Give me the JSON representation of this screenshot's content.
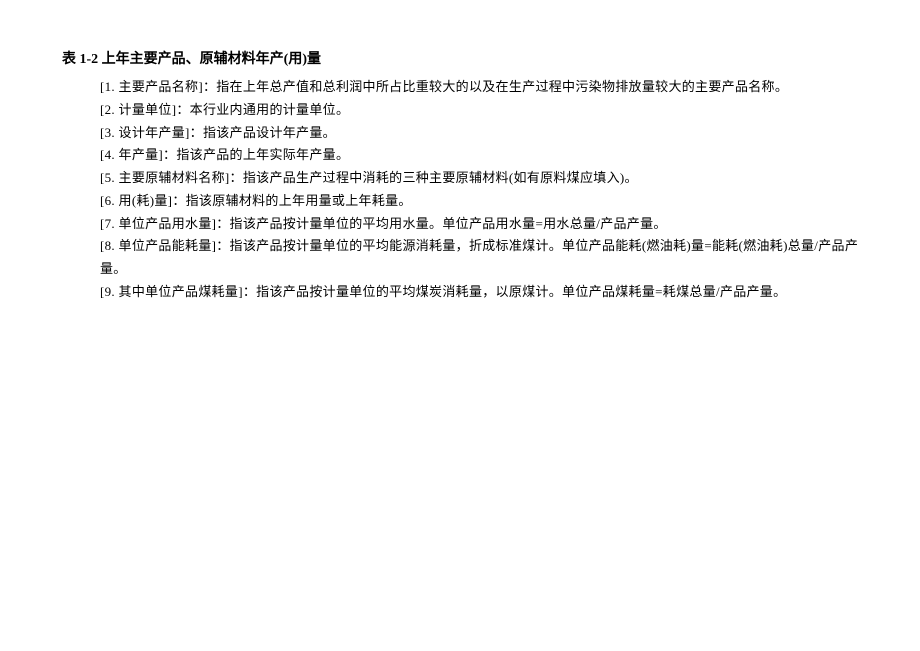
{
  "title": "表 1-2 上年主要产品、原辅材料年产(用)量",
  "items": [
    "[1. 主要产品名称]：指在上年总产值和总利润中所占比重较大的以及在生产过程中污染物排放量较大的主要产品名称。",
    "[2. 计量单位]：本行业内通用的计量单位。",
    "[3. 设计年产量]：指该产品设计年产量。",
    "[4. 年产量]：指该产品的上年实际年产量。",
    "[5. 主要原辅材料名称]：指该产品生产过程中消耗的三种主要原辅材料(如有原料煤应填入)。",
    "[6. 用(耗)量]：指该原辅材料的上年用量或上年耗量。",
    "[7. 单位产品用水量]：指该产品按计量单位的平均用水量。单位产品用水量=用水总量/产品产量。",
    "[8. 单位产品能耗量]：指该产品按计量单位的平均能源消耗量，折成标准煤计。单位产品能耗(燃油耗)量=能耗(燃油耗)总量/产品产量。",
    "[9. 其中单位产品煤耗量]：指该产品按计量单位的平均煤炭消耗量，以原煤计。单位产品煤耗量=耗煤总量/产品产量。"
  ]
}
